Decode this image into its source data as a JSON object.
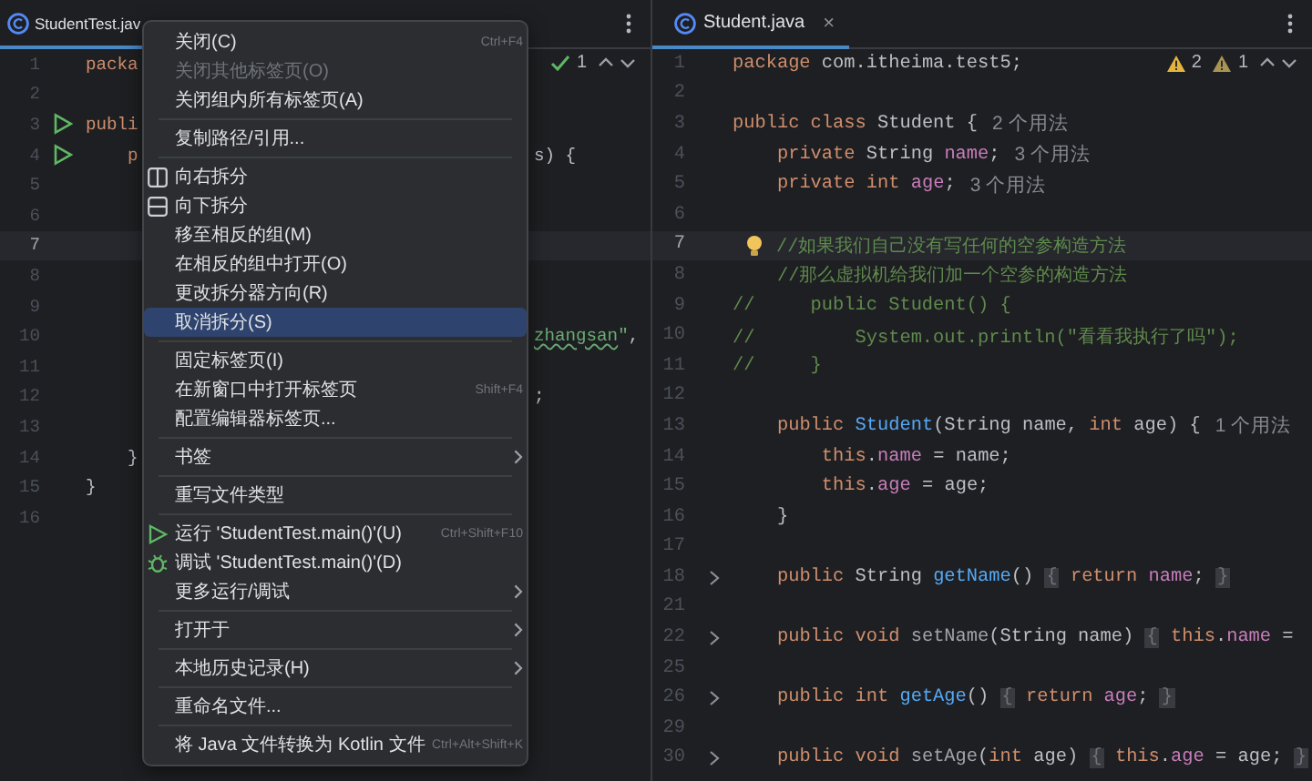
{
  "left_pane": {
    "tab": {
      "label": "StudentTest.jav",
      "selected": true
    },
    "inspection": {
      "count": "1"
    },
    "lines": [
      {
        "number": "1",
        "current": false,
        "run": false,
        "code": [
          {
            "kind": "kw",
            "text": "packa"
          }
        ]
      },
      {
        "number": "2",
        "current": false,
        "run": false
      },
      {
        "number": "3",
        "current": false,
        "run": true,
        "code": [
          {
            "kind": "kw",
            "text": "publi"
          }
        ]
      },
      {
        "number": "4",
        "current": false,
        "run": true,
        "code": [
          {
            "kind": "kw",
            "text": "    p"
          }
        ],
        "after": [
          {
            "kind": "plain",
            "text": "s) {"
          }
        ]
      },
      {
        "number": "5",
        "current": false,
        "run": false
      },
      {
        "number": "6",
        "current": false,
        "run": false
      },
      {
        "number": "7",
        "current": true,
        "run": false
      },
      {
        "number": "8",
        "current": false,
        "run": false
      },
      {
        "number": "9",
        "current": false,
        "run": false
      },
      {
        "number": "10",
        "current": false,
        "run": false,
        "after": [
          {
            "kind": "typo",
            "text": "zhangsan"
          },
          {
            "kind": "string",
            "text": "\""
          },
          {
            "kind": "plain",
            "text": ","
          }
        ]
      },
      {
        "number": "11",
        "current": false,
        "run": false
      },
      {
        "number": "12",
        "current": false,
        "run": false,
        "after": [
          {
            "kind": "plain",
            "text": ";"
          }
        ]
      },
      {
        "number": "13",
        "current": false,
        "run": false
      },
      {
        "number": "14",
        "current": false,
        "run": false,
        "code": [
          {
            "kind": "plain",
            "text": "    }"
          }
        ]
      },
      {
        "number": "15",
        "current": false,
        "run": false,
        "code": [
          {
            "kind": "plain",
            "text": "}"
          }
        ]
      },
      {
        "number": "16",
        "current": false,
        "run": false
      }
    ]
  },
  "context_menu": [
    {
      "kind": "item",
      "label": "关闭(C)",
      "shortcut": "Ctrl+F4",
      "disabled": false,
      "selected": false,
      "submenu": false
    },
    {
      "kind": "item",
      "label": "关闭其他标签页(O)",
      "disabled": true,
      "selected": false,
      "submenu": false
    },
    {
      "kind": "item",
      "label": "关闭组内所有标签页(A)",
      "disabled": false,
      "selected": false,
      "submenu": false
    },
    {
      "kind": "separator"
    },
    {
      "kind": "item",
      "label": "复制路径/引用...",
      "disabled": false,
      "selected": false,
      "submenu": false
    },
    {
      "kind": "separator"
    },
    {
      "kind": "vsplit",
      "label": "向右拆分",
      "disabled": false,
      "selected": false,
      "submenu": false
    },
    {
      "kind": "hsplit",
      "label": "向下拆分",
      "disabled": false,
      "selected": false,
      "submenu": false
    },
    {
      "kind": "item",
      "label": "移至相反的组(M)",
      "disabled": false,
      "selected": false,
      "submenu": false
    },
    {
      "kind": "item",
      "label": "在相反的组中打开(O)",
      "disabled": false,
      "selected": false,
      "submenu": false
    },
    {
      "kind": "item",
      "label": "更改拆分器方向(R)",
      "disabled": false,
      "selected": false,
      "submenu": false
    },
    {
      "kind": "item",
      "label": "取消拆分(S)",
      "disabled": false,
      "selected": true,
      "submenu": false
    },
    {
      "kind": "separator"
    },
    {
      "kind": "item",
      "label": "固定标签页(I)",
      "disabled": false,
      "selected": false,
      "submenu": false
    },
    {
      "kind": "item",
      "label": "在新窗口中打开标签页",
      "shortcut": "Shift+F4",
      "disabled": false,
      "selected": false,
      "submenu": false
    },
    {
      "kind": "item",
      "label": "配置编辑器标签页...",
      "disabled": false,
      "selected": false,
      "submenu": false
    },
    {
      "kind": "separator"
    },
    {
      "kind": "item",
      "label": "书签",
      "disabled": false,
      "selected": false,
      "submenu": true
    },
    {
      "kind": "separator"
    },
    {
      "kind": "item",
      "label": "重写文件类型",
      "disabled": false,
      "selected": false,
      "submenu": false
    },
    {
      "kind": "separator"
    },
    {
      "kind": "run",
      "label": "运行 'StudentTest.main()'(U)",
      "shortcut": "Ctrl+Shift+F10",
      "disabled": false,
      "selected": false,
      "submenu": false
    },
    {
      "kind": "debug",
      "label": "调试 'StudentTest.main()'(D)",
      "disabled": false,
      "selected": false,
      "submenu": false
    },
    {
      "kind": "item",
      "label": "更多运行/调试",
      "disabled": false,
      "selected": false,
      "submenu": true
    },
    {
      "kind": "separator"
    },
    {
      "kind": "item",
      "label": "打开于",
      "disabled": false,
      "selected": false,
      "submenu": true
    },
    {
      "kind": "separator"
    },
    {
      "kind": "item",
      "label": "本地历史记录(H)",
      "disabled": false,
      "selected": false,
      "submenu": true
    },
    {
      "kind": "separator"
    },
    {
      "kind": "item",
      "label": "重命名文件...",
      "disabled": false,
      "selected": false,
      "submenu": false
    },
    {
      "kind": "separator"
    },
    {
      "kind": "item",
      "label": "将 Java 文件转换为 Kotlin 文件",
      "shortcut": "Ctrl+Alt+Shift+K",
      "disabled": false,
      "selected": false,
      "submenu": false
    }
  ],
  "right_pane": {
    "tab": {
      "label": "Student.java",
      "close": "×",
      "selected": true
    },
    "inspection": {
      "warnings": "2",
      "weak_warnings": "1"
    },
    "lines": [
      {
        "number": "1",
        "current": false,
        "fold": false,
        "bulb": false,
        "code": [
          {
            "kind": "kw",
            "text": "package "
          },
          {
            "kind": "plain",
            "text": "com.itheima.test5;"
          }
        ]
      },
      {
        "number": "2",
        "current": false,
        "fold": false,
        "bulb": false
      },
      {
        "number": "3",
        "current": false,
        "fold": false,
        "bulb": false,
        "code": [
          {
            "kind": "kw",
            "text": "public class "
          },
          {
            "kind": "plain",
            "text": "Student {"
          }
        ],
        "hint": "2 个用法"
      },
      {
        "number": "4",
        "current": false,
        "fold": false,
        "bulb": false,
        "code": [
          {
            "kind": "kw",
            "text": "    private "
          },
          {
            "kind": "plain",
            "text": "String "
          },
          {
            "kind": "field",
            "text": "name"
          },
          {
            "kind": "plain",
            "text": ";"
          }
        ],
        "hint": "3 个用法"
      },
      {
        "number": "5",
        "current": false,
        "fold": false,
        "bulb": false,
        "code": [
          {
            "kind": "kw",
            "text": "    private int "
          },
          {
            "kind": "field",
            "text": "age"
          },
          {
            "kind": "plain",
            "text": ";"
          }
        ],
        "hint": "3 个用法"
      },
      {
        "number": "6",
        "current": false,
        "fold": false,
        "bulb": false
      },
      {
        "number": "7",
        "current": true,
        "fold": false,
        "bulb": true,
        "code": [
          {
            "kind": "comment",
            "text": "    //如果我们自己没有写任何的空参构造方法"
          }
        ]
      },
      {
        "number": "8",
        "current": false,
        "fold": false,
        "bulb": false,
        "code": [
          {
            "kind": "comment",
            "text": "    //那么虚拟机给我们加一个空参的构造方法"
          }
        ]
      },
      {
        "number": "9",
        "current": false,
        "fold": false,
        "bulb": false,
        "code": [
          {
            "kind": "comment",
            "text": "//     public Student() {"
          }
        ]
      },
      {
        "number": "10",
        "current": false,
        "fold": false,
        "bulb": false,
        "code": [
          {
            "kind": "comment",
            "text": "//         System.out.println(\"看看我执行了吗\");"
          }
        ]
      },
      {
        "number": "11",
        "current": false,
        "fold": false,
        "bulb": false,
        "code": [
          {
            "kind": "comment",
            "text": "//     }"
          }
        ]
      },
      {
        "number": "12",
        "current": false,
        "fold": false,
        "bulb": false
      },
      {
        "number": "13",
        "current": false,
        "fold": false,
        "bulb": false,
        "code": [
          {
            "kind": "kw",
            "text": "    public "
          },
          {
            "kind": "method",
            "text": "Student"
          },
          {
            "kind": "plain",
            "text": "(String name, "
          },
          {
            "kind": "kw",
            "text": "int "
          },
          {
            "kind": "plain",
            "text": "age) {"
          }
        ],
        "hint": "1 个用法"
      },
      {
        "number": "14",
        "current": false,
        "fold": false,
        "bulb": false,
        "code": [
          {
            "kind": "kw",
            "text": "        this"
          },
          {
            "kind": "plain",
            "text": "."
          },
          {
            "kind": "field",
            "text": "name"
          },
          {
            "kind": "plain",
            "text": " = name;"
          }
        ]
      },
      {
        "number": "15",
        "current": false,
        "fold": false,
        "bulb": false,
        "code": [
          {
            "kind": "kw",
            "text": "        this"
          },
          {
            "kind": "plain",
            "text": "."
          },
          {
            "kind": "field",
            "text": "age"
          },
          {
            "kind": "plain",
            "text": " = age;"
          }
        ]
      },
      {
        "number": "16",
        "current": false,
        "fold": false,
        "bulb": false,
        "code": [
          {
            "kind": "plain",
            "text": "    }"
          }
        ]
      },
      {
        "number": "17",
        "current": false,
        "fold": false,
        "bulb": false
      },
      {
        "number": "18",
        "current": false,
        "fold": true,
        "bulb": false,
        "code": [
          {
            "kind": "kw",
            "text": "    public "
          },
          {
            "kind": "plain",
            "text": "String "
          },
          {
            "kind": "method",
            "text": "getName"
          },
          {
            "kind": "plain",
            "text": "() "
          },
          {
            "kind": "folded",
            "text": "{"
          },
          {
            "kind": "kw",
            "text": " return "
          },
          {
            "kind": "field",
            "text": "name"
          },
          {
            "kind": "plain",
            "text": "; "
          },
          {
            "kind": "folded",
            "text": "}"
          }
        ]
      },
      {
        "number": "21",
        "current": false,
        "fold": false,
        "bulb": false
      },
      {
        "number": "22",
        "current": false,
        "fold": true,
        "bulb": false,
        "code": [
          {
            "kind": "kw",
            "text": "    public void "
          },
          {
            "kind": "dim",
            "text": "setName"
          },
          {
            "kind": "plain",
            "text": "(String name) "
          },
          {
            "kind": "folded",
            "text": "{"
          },
          {
            "kind": "kw",
            "text": " this"
          },
          {
            "kind": "plain",
            "text": "."
          },
          {
            "kind": "field",
            "text": "name"
          },
          {
            "kind": "plain",
            "text": " ="
          }
        ]
      },
      {
        "number": "25",
        "current": false,
        "fold": false,
        "bulb": false
      },
      {
        "number": "26",
        "current": false,
        "fold": true,
        "bulb": false,
        "code": [
          {
            "kind": "kw",
            "text": "    public int "
          },
          {
            "kind": "method",
            "text": "getAge"
          },
          {
            "kind": "plain",
            "text": "() "
          },
          {
            "kind": "folded",
            "text": "{"
          },
          {
            "kind": "kw",
            "text": " return "
          },
          {
            "kind": "field",
            "text": "age"
          },
          {
            "kind": "plain",
            "text": "; "
          },
          {
            "kind": "folded",
            "text": "}"
          }
        ]
      },
      {
        "number": "29",
        "current": false,
        "fold": false,
        "bulb": false
      },
      {
        "number": "30",
        "current": false,
        "fold": true,
        "bulb": false,
        "code": [
          {
            "kind": "kw",
            "text": "    public void "
          },
          {
            "kind": "dim",
            "text": "setAge"
          },
          {
            "kind": "plain",
            "text": "("
          },
          {
            "kind": "kw",
            "text": "int "
          },
          {
            "kind": "plain",
            "text": "age) "
          },
          {
            "kind": "folded",
            "text": "{"
          },
          {
            "kind": "kw",
            "text": " this"
          },
          {
            "kind": "plain",
            "text": "."
          },
          {
            "kind": "field",
            "text": "age"
          },
          {
            "kind": "plain",
            "text": " = age; "
          },
          {
            "kind": "folded",
            "text": "}"
          }
        ]
      }
    ]
  }
}
